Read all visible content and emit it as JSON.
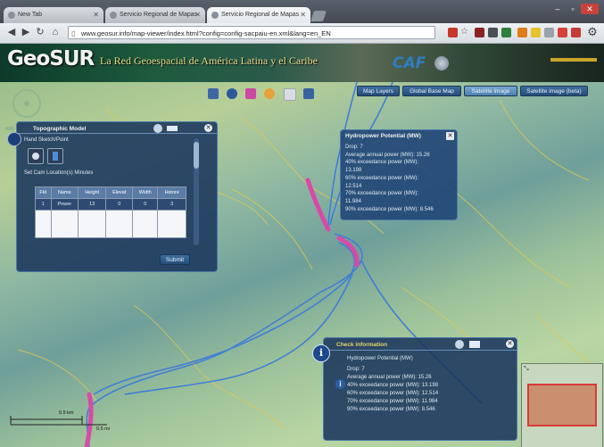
{
  "browser": {
    "tabs": [
      {
        "label": "New Tab"
      },
      {
        "label": "Servicio Regional de Mapas"
      },
      {
        "label": "Servicio Regional de Mapas"
      }
    ],
    "url": "www.geosur.info/map-viewer/index.html?config=config-sacpaiu-en.xml&lang=en_EN"
  },
  "header": {
    "logo": "GeoSUR",
    "tagline": "La Red Geoespacial de América Latina y el Caribe",
    "partner_logo": "CAF"
  },
  "map_toolbar": {
    "buttons": [
      {
        "label": "Map Layers"
      },
      {
        "label": "Global Base Map"
      },
      {
        "label": "Satellite image"
      },
      {
        "label": "Satellite image (beta)"
      }
    ]
  },
  "topo_panel": {
    "title": "Topographic Model",
    "hand_label": "Hand Sketch/Point",
    "set_label": "Set Cam Location(s) Minutes",
    "table_headers": [
      "Fld",
      "Name",
      "Height",
      "Elevat",
      "Width",
      "Hstore"
    ],
    "table_rows": [
      [
        "1",
        "Power",
        "13",
        "0",
        "0",
        "3"
      ]
    ],
    "submit": "Submit"
  },
  "hydro_popup": {
    "title": "Hydropower Potential (MW)",
    "lines": [
      "Drop: 7",
      "Average annual power (MW): 15.26",
      "40% exceedance power (MW):",
      "13.198",
      "60% exceedance power (MW):",
      "12.514",
      "70% exceedance power (MW):",
      "11.984",
      "90% exceedance power (MW): 8.546"
    ]
  },
  "check_panel": {
    "title": "Check information",
    "subtitle": "Hydropower Potential (MW)",
    "lines": [
      "Drop: 7",
      "Average annual power (MW): 15.26",
      "40% exceedance power (MW): 13.198",
      "60% exceedance power (MW): 12.514",
      "70% exceedance power (MW): 11.984",
      "90% exceedance power (MW): 8.546"
    ]
  },
  "scale": {
    "top": "0.5 km",
    "bottom": "0.5 mi"
  },
  "colors": {
    "river": "#3f7fd6",
    "highlight": "#d94aa8",
    "panel": "#1a365c",
    "contour": "#e0c850"
  }
}
